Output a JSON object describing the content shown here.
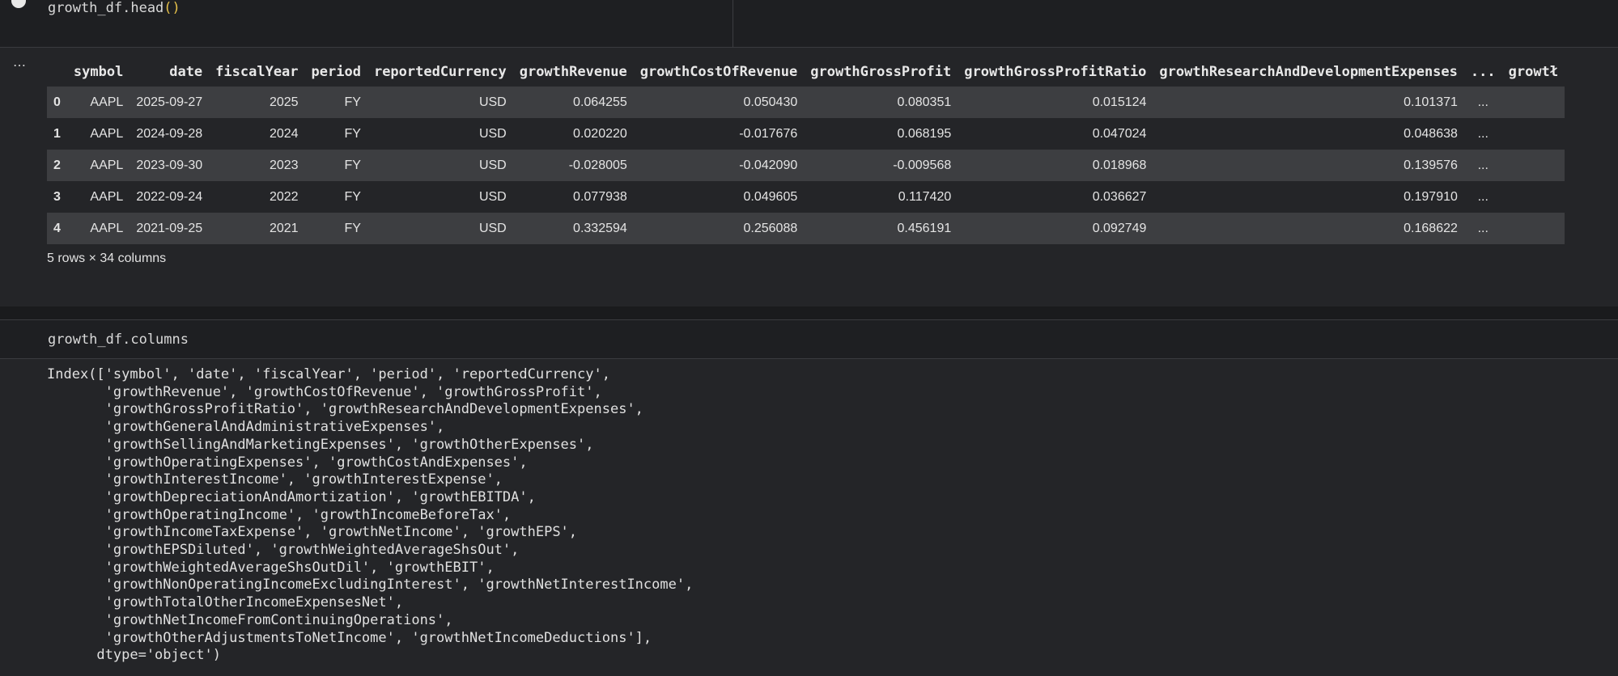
{
  "cell1": {
    "code": "growth_df.head",
    "paren": "()",
    "output_menu": "…",
    "table": {
      "headers": [
        "",
        "symbol",
        "date",
        "fiscalYear",
        "period",
        "reportedCurrency",
        "growthRevenue",
        "growthCostOfRevenue",
        "growthGrossProfit",
        "growthGrossProfitRatio",
        "growthResearchAndDevelopmentExpenses",
        "...",
        "growtł"
      ],
      "rows": [
        [
          "0",
          "AAPL",
          "2025-09-27",
          "2025",
          "FY",
          "USD",
          "0.064255",
          "0.050430",
          "0.080351",
          "0.015124",
          "0.101371",
          "...",
          ""
        ],
        [
          "1",
          "AAPL",
          "2024-09-28",
          "2024",
          "FY",
          "USD",
          "0.020220",
          "-0.017676",
          "0.068195",
          "0.047024",
          "0.048638",
          "...",
          ""
        ],
        [
          "2",
          "AAPL",
          "2023-09-30",
          "2023",
          "FY",
          "USD",
          "-0.028005",
          "-0.042090",
          "-0.009568",
          "0.018968",
          "0.139576",
          "...",
          ""
        ],
        [
          "3",
          "AAPL",
          "2022-09-24",
          "2022",
          "FY",
          "USD",
          "0.077938",
          "0.049605",
          "0.117420",
          "0.036627",
          "0.197910",
          "...",
          ""
        ],
        [
          "4",
          "AAPL",
          "2021-09-25",
          "2021",
          "FY",
          "USD",
          "0.332594",
          "0.256088",
          "0.456191",
          "0.092749",
          "0.168622",
          "...",
          ""
        ]
      ]
    },
    "shape_note": "5 rows × 34 columns"
  },
  "cell2": {
    "code": "growth_df.columns",
    "output": "Index(['symbol', 'date', 'fiscalYear', 'period', 'reportedCurrency',\n       'growthRevenue', 'growthCostOfRevenue', 'growthGrossProfit',\n       'growthGrossProfitRatio', 'growthResearchAndDevelopmentExpenses',\n       'growthGeneralAndAdministrativeExpenses',\n       'growthSellingAndMarketingExpenses', 'growthOtherExpenses',\n       'growthOperatingExpenses', 'growthCostAndExpenses',\n       'growthInterestIncome', 'growthInterestExpense',\n       'growthDepreciationAndAmortization', 'growthEBITDA',\n       'growthOperatingIncome', 'growthIncomeBeforeTax',\n       'growthIncomeTaxExpense', 'growthNetIncome', 'growthEPS',\n       'growthEPSDiluted', 'growthWeightedAverageShsOut',\n       'growthWeightedAverageShsOutDil', 'growthEBIT',\n       'growthNonOperatingIncomeExcludingInterest', 'growthNetInterestIncome',\n       'growthTotalOtherIncomeExpensesNet',\n       'growthNetIncomeFromContinuingOperations',\n       'growthOtherAdjustmentsToNetIncome', 'growthNetIncomeDeductions'],\n      dtype='object')"
  }
}
